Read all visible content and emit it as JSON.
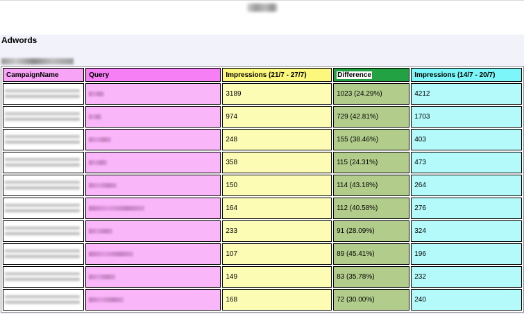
{
  "section": {
    "title": "Adwords"
  },
  "table": {
    "headers": {
      "campaign": "CampaignName",
      "query": "Query",
      "impressions_current": "Impressions (21/7 - 27/7)",
      "difference": "Difference",
      "impressions_previous": "Impressions (14/7 - 20/7)"
    },
    "rows": [
      {
        "impressions_current": "3189",
        "difference": "1023 (24.29%)",
        "impressions_previous": "4212"
      },
      {
        "impressions_current": "974",
        "difference": "729 (42.81%)",
        "impressions_previous": "1703"
      },
      {
        "impressions_current": "248",
        "difference": "155 (38.46%)",
        "impressions_previous": "403"
      },
      {
        "impressions_current": "358",
        "difference": "115 (24.31%)",
        "impressions_previous": "473"
      },
      {
        "impressions_current": "150",
        "difference": "114 (43.18%)",
        "impressions_previous": "264"
      },
      {
        "impressions_current": "164",
        "difference": "112 (40.58%)",
        "impressions_previous": "276"
      },
      {
        "impressions_current": "233",
        "difference": "91 (28.09%)",
        "impressions_previous": "324"
      },
      {
        "impressions_current": "107",
        "difference": "89 (45.41%)",
        "impressions_previous": "196"
      },
      {
        "impressions_current": "149",
        "difference": "83 (35.78%)",
        "impressions_previous": "232"
      },
      {
        "impressions_current": "168",
        "difference": "72 (30.00%)",
        "impressions_previous": "240"
      }
    ]
  },
  "colors": {
    "query_cell": "#f9b6f8",
    "impressions_current_cell": "#fdfcb5",
    "difference_cell": "#b2cd8b",
    "impressions_previous_cell": "#b4fafb",
    "difference_header": "#23a244"
  }
}
